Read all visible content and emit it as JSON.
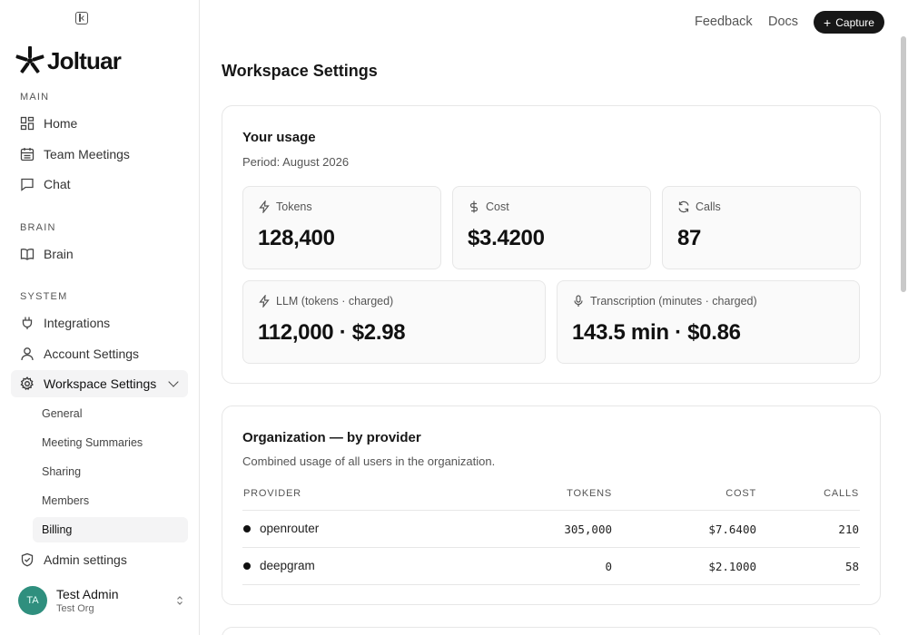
{
  "app": {
    "name": "Joltuar"
  },
  "topbar": {
    "feedback": "Feedback",
    "docs": "Docs",
    "capture": "Capture"
  },
  "sidebar": {
    "sections": {
      "main": "MAIN",
      "brain": "BRAIN",
      "system": "SYSTEM"
    },
    "main_items": [
      {
        "label": "Home",
        "icon": "grid-icon"
      },
      {
        "label": "Team Meetings",
        "icon": "calendar-icon"
      },
      {
        "label": "Chat",
        "icon": "chat-icon"
      }
    ],
    "brain_items": [
      {
        "label": "Brain",
        "icon": "book-icon"
      }
    ],
    "system_items": [
      {
        "label": "Integrations",
        "icon": "plug-icon"
      },
      {
        "label": "Account Settings",
        "icon": "user-icon"
      },
      {
        "label": "Workspace Settings",
        "icon": "gear-icon"
      }
    ],
    "workspace_sub": [
      "General",
      "Meeting Summaries",
      "Sharing",
      "Members",
      "Billing"
    ],
    "admin": {
      "label": "Admin settings",
      "icon": "shield-icon"
    },
    "user": {
      "initials": "TA",
      "name": "Test Admin",
      "org": "Test Org"
    }
  },
  "page": {
    "title": "Workspace Settings"
  },
  "usage": {
    "title": "Your usage",
    "period": "Period: August 2026",
    "stats": [
      {
        "label": "Tokens",
        "value": "128,400",
        "icon": "bolt-icon"
      },
      {
        "label": "Cost",
        "value": "$3.4200",
        "icon": "dollar-icon"
      },
      {
        "label": "Calls",
        "value": "87",
        "icon": "refresh-icon"
      }
    ],
    "breakdown": [
      {
        "label": "LLM (tokens · charged)",
        "value": "112,000 · $2.98",
        "icon": "bolt-icon"
      },
      {
        "label": "Transcription (minutes · charged)",
        "value": "143.5 min · $0.86",
        "icon": "mic-icon"
      }
    ]
  },
  "org": {
    "title": "Organization — by provider",
    "subtitle": "Combined usage of all users in the organization.",
    "columns": [
      "PROVIDER",
      "TOKENS",
      "COST",
      "CALLS"
    ],
    "rows": [
      {
        "provider": "openrouter",
        "tokens": "305,000",
        "cost": "$7.6400",
        "calls": "210"
      },
      {
        "provider": "deepgram",
        "tokens": "0",
        "cost": "$2.1000",
        "calls": "58"
      }
    ]
  }
}
